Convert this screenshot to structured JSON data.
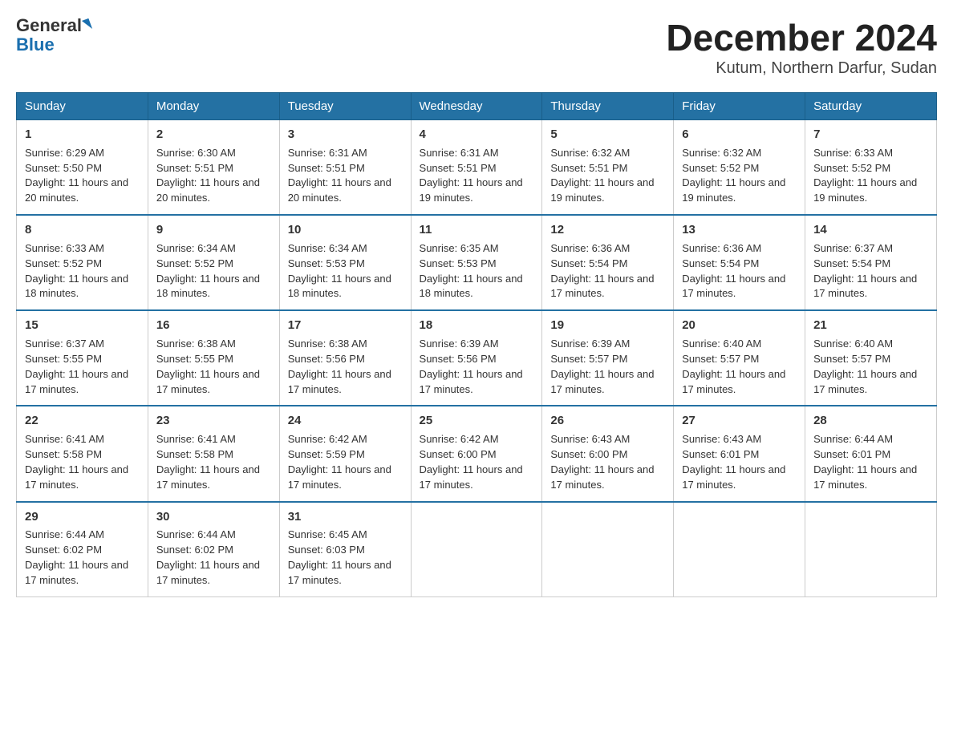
{
  "logo": {
    "general": "General",
    "blue": "Blue"
  },
  "title": "December 2024",
  "subtitle": "Kutum, Northern Darfur, Sudan",
  "days_of_week": [
    "Sunday",
    "Monday",
    "Tuesday",
    "Wednesday",
    "Thursday",
    "Friday",
    "Saturday"
  ],
  "weeks": [
    [
      {
        "day": "1",
        "sunrise": "6:29 AM",
        "sunset": "5:50 PM",
        "daylight": "11 hours and 20 minutes."
      },
      {
        "day": "2",
        "sunrise": "6:30 AM",
        "sunset": "5:51 PM",
        "daylight": "11 hours and 20 minutes."
      },
      {
        "day": "3",
        "sunrise": "6:31 AM",
        "sunset": "5:51 PM",
        "daylight": "11 hours and 20 minutes."
      },
      {
        "day": "4",
        "sunrise": "6:31 AM",
        "sunset": "5:51 PM",
        "daylight": "11 hours and 19 minutes."
      },
      {
        "day": "5",
        "sunrise": "6:32 AM",
        "sunset": "5:51 PM",
        "daylight": "11 hours and 19 minutes."
      },
      {
        "day": "6",
        "sunrise": "6:32 AM",
        "sunset": "5:52 PM",
        "daylight": "11 hours and 19 minutes."
      },
      {
        "day": "7",
        "sunrise": "6:33 AM",
        "sunset": "5:52 PM",
        "daylight": "11 hours and 19 minutes."
      }
    ],
    [
      {
        "day": "8",
        "sunrise": "6:33 AM",
        "sunset": "5:52 PM",
        "daylight": "11 hours and 18 minutes."
      },
      {
        "day": "9",
        "sunrise": "6:34 AM",
        "sunset": "5:52 PM",
        "daylight": "11 hours and 18 minutes."
      },
      {
        "day": "10",
        "sunrise": "6:34 AM",
        "sunset": "5:53 PM",
        "daylight": "11 hours and 18 minutes."
      },
      {
        "day": "11",
        "sunrise": "6:35 AM",
        "sunset": "5:53 PM",
        "daylight": "11 hours and 18 minutes."
      },
      {
        "day": "12",
        "sunrise": "6:36 AM",
        "sunset": "5:54 PM",
        "daylight": "11 hours and 17 minutes."
      },
      {
        "day": "13",
        "sunrise": "6:36 AM",
        "sunset": "5:54 PM",
        "daylight": "11 hours and 17 minutes."
      },
      {
        "day": "14",
        "sunrise": "6:37 AM",
        "sunset": "5:54 PM",
        "daylight": "11 hours and 17 minutes."
      }
    ],
    [
      {
        "day": "15",
        "sunrise": "6:37 AM",
        "sunset": "5:55 PM",
        "daylight": "11 hours and 17 minutes."
      },
      {
        "day": "16",
        "sunrise": "6:38 AM",
        "sunset": "5:55 PM",
        "daylight": "11 hours and 17 minutes."
      },
      {
        "day": "17",
        "sunrise": "6:38 AM",
        "sunset": "5:56 PM",
        "daylight": "11 hours and 17 minutes."
      },
      {
        "day": "18",
        "sunrise": "6:39 AM",
        "sunset": "5:56 PM",
        "daylight": "11 hours and 17 minutes."
      },
      {
        "day": "19",
        "sunrise": "6:39 AM",
        "sunset": "5:57 PM",
        "daylight": "11 hours and 17 minutes."
      },
      {
        "day": "20",
        "sunrise": "6:40 AM",
        "sunset": "5:57 PM",
        "daylight": "11 hours and 17 minutes."
      },
      {
        "day": "21",
        "sunrise": "6:40 AM",
        "sunset": "5:57 PM",
        "daylight": "11 hours and 17 minutes."
      }
    ],
    [
      {
        "day": "22",
        "sunrise": "6:41 AM",
        "sunset": "5:58 PM",
        "daylight": "11 hours and 17 minutes."
      },
      {
        "day": "23",
        "sunrise": "6:41 AM",
        "sunset": "5:58 PM",
        "daylight": "11 hours and 17 minutes."
      },
      {
        "day": "24",
        "sunrise": "6:42 AM",
        "sunset": "5:59 PM",
        "daylight": "11 hours and 17 minutes."
      },
      {
        "day": "25",
        "sunrise": "6:42 AM",
        "sunset": "6:00 PM",
        "daylight": "11 hours and 17 minutes."
      },
      {
        "day": "26",
        "sunrise": "6:43 AM",
        "sunset": "6:00 PM",
        "daylight": "11 hours and 17 minutes."
      },
      {
        "day": "27",
        "sunrise": "6:43 AM",
        "sunset": "6:01 PM",
        "daylight": "11 hours and 17 minutes."
      },
      {
        "day": "28",
        "sunrise": "6:44 AM",
        "sunset": "6:01 PM",
        "daylight": "11 hours and 17 minutes."
      }
    ],
    [
      {
        "day": "29",
        "sunrise": "6:44 AM",
        "sunset": "6:02 PM",
        "daylight": "11 hours and 17 minutes."
      },
      {
        "day": "30",
        "sunrise": "6:44 AM",
        "sunset": "6:02 PM",
        "daylight": "11 hours and 17 minutes."
      },
      {
        "day": "31",
        "sunrise": "6:45 AM",
        "sunset": "6:03 PM",
        "daylight": "11 hours and 17 minutes."
      },
      null,
      null,
      null,
      null
    ]
  ],
  "labels": {
    "sunrise": "Sunrise:",
    "sunset": "Sunset:",
    "daylight": "Daylight:"
  },
  "colors": {
    "header_bg": "#2471a3",
    "header_text": "#ffffff",
    "border": "#2471a3"
  }
}
